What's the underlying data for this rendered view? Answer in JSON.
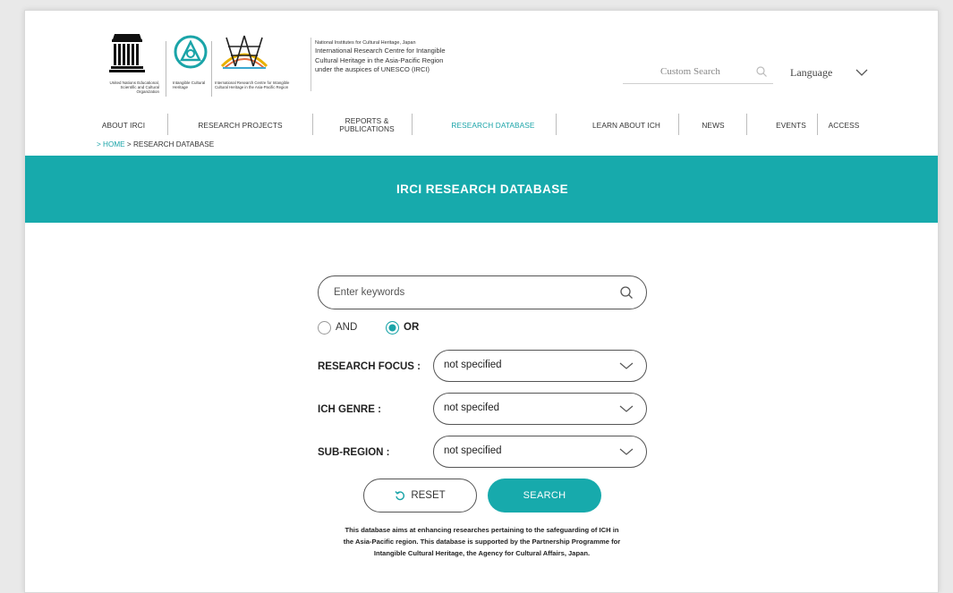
{
  "header": {
    "unesco_org": "United Nations Educational, Scientific and Cultural Organization",
    "ich_label": "Intangible Cultural Heritage",
    "irci_label": "International Research Centre for Intangible Cultural Heritage in the Asia-Pacific Region",
    "org_line_small": "National Institutes for Cultural Heritage, Japan",
    "org_line_1": "International Research Centre for Intangible",
    "org_line_2": "Cultural Heritage in the Asia-Pacific Region",
    "org_line_3": "under the auspices of UNESCO (IRCI)",
    "search_placeholder": "Custom Search",
    "language_label": "Language"
  },
  "nav": {
    "items": [
      {
        "label": "ABOUT IRCI"
      },
      {
        "label": "RESEARCH PROJECTS"
      },
      {
        "label": "REPORTS & PUBLICATIONS"
      },
      {
        "label": "RESEARCH DATABASE"
      },
      {
        "label": "LEARN ABOUT ICH"
      },
      {
        "label": "NEWS"
      },
      {
        "label": "EVENTS"
      },
      {
        "label": "ACCESS"
      }
    ],
    "active": "RESEARCH DATABASE"
  },
  "breadcrumb": {
    "home": "> HOME",
    "current": " > RESEARCH DATABASE"
  },
  "banner": {
    "title": "IRCI RESEARCH DATABASE"
  },
  "form": {
    "keyword_placeholder": "Enter keywords",
    "radio_and": "AND",
    "radio_or": "OR",
    "selected_operator": "OR",
    "research_focus_label": "RESEARCH FOCUS :",
    "research_focus_value": "not specified",
    "ich_genre_label": "ICH GENRE :",
    "ich_genre_value": "not specifed",
    "sub_region_label": "SUB-REGION :",
    "sub_region_value": "not specified",
    "reset_label": "RESET",
    "search_label": "SEARCH"
  },
  "note": {
    "text": "This database aims at enhancing researches pertaining to the safeguarding of ICH in the Asia-Pacific region. This database is supported by the Partnership Programme for Intangible Cultural Heritage, the Agency for Cultural Affairs, Japan."
  },
  "colors": {
    "accent": "#17aaac",
    "text": "#222222"
  }
}
